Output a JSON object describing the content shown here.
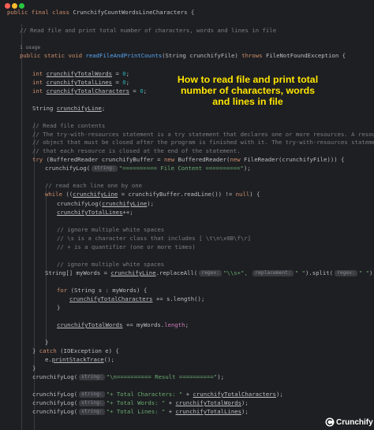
{
  "window": {
    "title": "CrunchifyCountWordsLineCharacters"
  },
  "lines": {
    "l1": {
      "a": "public final class ",
      "b": "CrunchifyCountWordsLineCharacters",
      "c": " {"
    },
    "l2": {
      "a": "// Read file and print total number of characters, words and lines in file"
    },
    "usage": "1 usage",
    "l3": {
      "a": "public static void ",
      "b": "readFileAndPrintCounts",
      "c": "(String crunchifyFile) ",
      "d": "throws ",
      "e": "FileNotFoundException {"
    },
    "l4": {
      "a": "int ",
      "b": "crunchifyTotalWords",
      "c": " = ",
      "d": "0",
      "e": ";"
    },
    "l5": {
      "a": "int ",
      "b": "crunchifyTotalLines",
      "c": " = ",
      "d": "0",
      "e": ";"
    },
    "l6": {
      "a": "int ",
      "b": "crunchifyTotalCharacters",
      "c": " = ",
      "d": "0",
      "e": ";"
    },
    "l7": {
      "a": "String ",
      "b": "crunchifyLine",
      "c": ";"
    },
    "c1": "// Read file contents",
    "c2": "// The try-with-resources statement is a try statement that declares one or more resources. A resource is an",
    "c3": "// object that must be closed after the program is finished with it. The try-with-resources statement ensures",
    "c4": "// that each resource is closed at the end of the statement.",
    "l8": {
      "a": "try ",
      "b": "(BufferedReader crunchifyBuffer = ",
      "c": "new ",
      "d": "BufferedReader(",
      "e": "new ",
      "f": "FileReader(crunchifyFile))) {"
    },
    "l9": {
      "a": "crunchifyLog",
      "b": "(",
      "hint": "string:",
      "c": "\"========== File Content ==========\"",
      "d": ");"
    },
    "c5": "// read each line one by one",
    "l10": {
      "a": "while ",
      "b": "((",
      "c": "crunchifyLine",
      "d": " = crunchifyBuffer.readLine()) != ",
      "e": "null",
      "f": ") {"
    },
    "l11": {
      "a": "crunchifyLog(",
      "b": "crunchifyLine",
      "c": ");"
    },
    "l12": {
      "a": "crunchifyTotalLines",
      "b": "++;"
    },
    "c6": "// ignore multiple white spaces",
    "c7": "// \\s is a character class that includes [ \\t\\n\\x0B\\f\\r]",
    "c8": "// + is a quantifier (one or more times)",
    "c9": "// ignore multiple white spaces",
    "l13": {
      "a": "String[] myWords = ",
      "b": "crunchifyLine",
      "c": ".replaceAll(",
      "hint1": "regex:",
      "d": "\"",
      "e": "\\\\s+",
      "f": "\", ",
      "hint2": "replacement:",
      "g": "\" \"",
      "h": ").split(",
      "hint3": "regex:",
      "i": "\" \"",
      "j": ");"
    },
    "l14": {
      "a": "for ",
      "b": "(String s : myWords) {"
    },
    "l15": {
      "a": "crunchifyTotalCharacters",
      "b": " += s.length();"
    },
    "l16": {
      "a": "}"
    },
    "l17": {
      "a": "crunchifyTotalWords",
      "b": " += myWords.",
      "c": "length",
      "d": ";"
    },
    "l18": {
      "a": "}"
    },
    "l19": {
      "a": "} ",
      "b": "catch ",
      "c": "(IOException e) {"
    },
    "l20": {
      "a": "e.",
      "b": "printStackTrace",
      "c": "();"
    },
    "l21": {
      "a": "}"
    },
    "l22": {
      "a": "crunchifyLog(",
      "hint": "string:",
      "b": "\"\\n========== Result ==========\"",
      "c": ");"
    },
    "l23": {
      "a": "crunchifyLog(",
      "hint": "string:",
      "b": "\"+ Total Characters: \"",
      "c": " + ",
      "d": "crunchifyTotalCharacters",
      "e": ");"
    },
    "l24": {
      "a": "crunchifyLog(",
      "hint": "string:",
      "b": "\"+ Total Words: \"",
      "c": " + ",
      "d": "crunchifyTotalWords",
      "e": ");"
    },
    "l25": {
      "a": "crunchifyLog(",
      "hint": "string:",
      "b": "\"+ Total Lines: \"",
      "c": " + ",
      "d": "crunchifyTotalLines",
      "e": ");"
    }
  },
  "overlay": {
    "line1": "How to read file and print total",
    "line2": "number of characters, words and lines in file"
  },
  "logo": {
    "text": "Crunchify"
  },
  "colors": {
    "keyword": "#cf8e6d",
    "function": "#56a8f5",
    "field": "#c77dbb",
    "string": "#6aab73",
    "number": "#2aacb8",
    "comment": "#7a7e85",
    "overlay": "#ffe500",
    "background": "#1e1f22"
  },
  "icons": {
    "window_close": "red-dot-icon",
    "window_minimize": "yellow-dot-icon",
    "window_zoom": "green-dot-icon",
    "logo": "crunchify-logo-icon"
  }
}
